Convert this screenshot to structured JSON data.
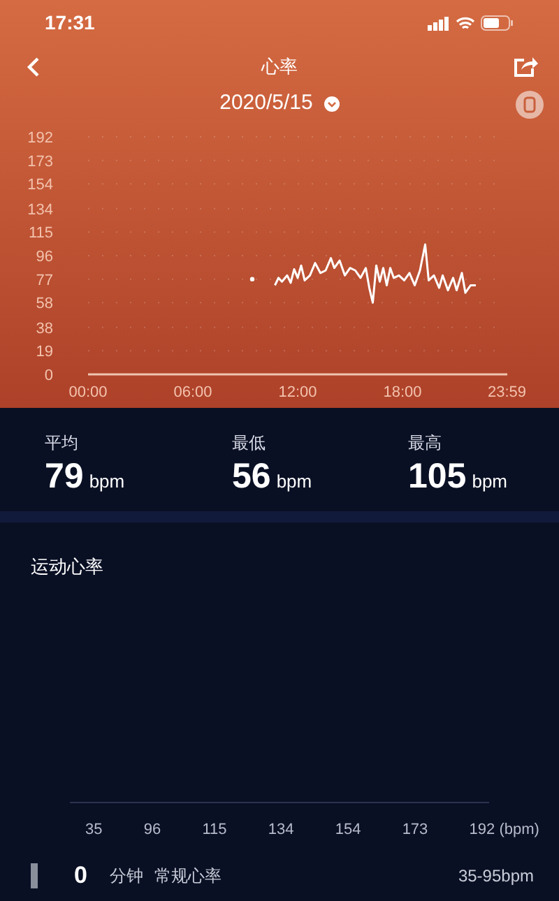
{
  "status_bar": {
    "time": "17:31"
  },
  "header": {
    "title": "心率",
    "date": "2020/5/15"
  },
  "chart_data": {
    "type": "line",
    "grid": true,
    "xlim": [
      0,
      24
    ],
    "ylim": [
      0,
      192
    ],
    "xticks": [
      {
        "value": 0,
        "label": "00:00"
      },
      {
        "value": 6,
        "label": "06:00"
      },
      {
        "value": 12,
        "label": "12:00"
      },
      {
        "value": 18,
        "label": "18:00"
      },
      {
        "value": 23.98,
        "label": "23:59"
      }
    ],
    "yticks": [
      0,
      19,
      38,
      58,
      77,
      96,
      115,
      134,
      154,
      173,
      192
    ],
    "x": [
      9.4,
      10,
      10.7,
      10.9,
      11.1,
      11.4,
      11.6,
      11.8,
      12.0,
      12.2,
      12.4,
      12.7,
      13.0,
      13.3,
      13.6,
      13.9,
      14.1,
      14.4,
      14.7,
      15.0,
      15.3,
      15.6,
      15.9,
      16.1,
      16.3,
      16.5,
      16.7,
      16.9,
      17.1,
      17.3,
      17.5,
      17.8,
      18.1,
      18.4,
      18.7,
      19.0,
      19.3,
      19.5,
      19.8,
      20.1,
      20.3,
      20.6,
      20.9,
      21.1,
      21.4,
      21.6,
      21.9,
      22.2
    ],
    "series": [
      {
        "color": "#ffffff",
        "values": [
          77,
          null,
          72,
          78,
          75,
          80,
          74,
          85,
          78,
          88,
          76,
          80,
          90,
          82,
          84,
          94,
          86,
          92,
          80,
          86,
          84,
          78,
          86,
          70,
          58,
          88,
          75,
          86,
          72,
          86,
          78,
          80,
          76,
          82,
          72,
          84,
          105,
          76,
          80,
          70,
          80,
          68,
          78,
          68,
          82,
          66,
          72,
          72
        ]
      }
    ]
  },
  "stats": [
    {
      "label": "平均",
      "value": "79",
      "unit": "bpm"
    },
    {
      "label": "最低",
      "value": "56",
      "unit": "bpm"
    },
    {
      "label": "最高",
      "value": "105",
      "unit": "bpm"
    }
  ],
  "exercise": {
    "title": "运动心率",
    "axis_labels": [
      "35",
      "96",
      "115",
      "134",
      "154",
      "173",
      "192 (bpm)"
    ],
    "zones": [
      {
        "minutes": "0",
        "unit": "分钟",
        "name": "常规心率",
        "range": "35-95bpm"
      }
    ]
  }
}
